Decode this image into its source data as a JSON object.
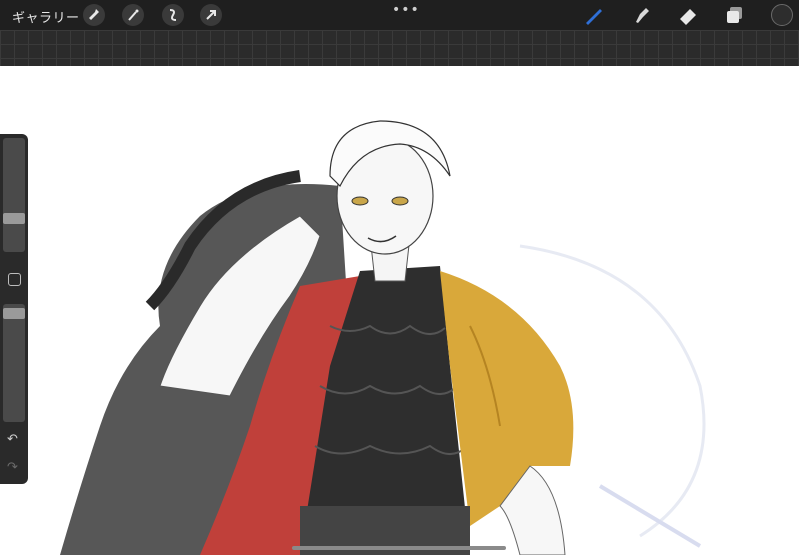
{
  "toolbar": {
    "gallery_label": "ギャラリー",
    "more_dots": "•••",
    "left_tools": [
      "wrench-icon",
      "magic-wand-icon",
      "selection-icon",
      "transform-icon"
    ],
    "right_tools": [
      "brush-icon",
      "smudge-icon",
      "eraser-icon",
      "layers-icon"
    ],
    "active_tool": "brush",
    "accent_color": "#2f6fd6",
    "current_color": "#2d2d2d"
  },
  "sidebar": {
    "brush_size": 0.35,
    "opacity": 1.0,
    "undo_icon": "↶",
    "redo_icon": "↷"
  },
  "artwork": {
    "colors": {
      "hair_long": "#3a3a3a",
      "red_vest": "#c0403a",
      "ruffle_shirt": "#2e2e2e",
      "yellow_cloth": "#d9a83a",
      "skin": "#f2f2f2"
    }
  }
}
